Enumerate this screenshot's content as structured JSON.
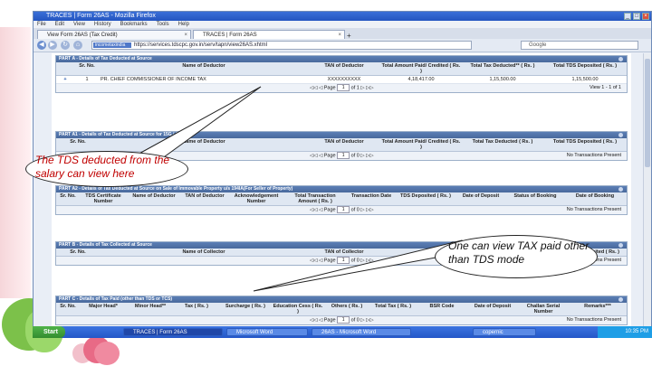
{
  "window": {
    "title": "TRACES | Form 26AS - Mozilla Firefox",
    "controls": [
      "_",
      "□",
      "×"
    ]
  },
  "menu": [
    "File",
    "Edit",
    "View",
    "History",
    "Bookmarks",
    "Tools",
    "Help"
  ],
  "tabs": [
    {
      "label": "View Form 26AS (Tax Credit)"
    },
    {
      "label": "TRACES | Form 26AS"
    }
  ],
  "address": {
    "badge": "incometaxindia",
    "url": "https://services.tdscpc.gov.in/serv/tapn/view26AS.xhtml",
    "search_placeholder": "Google"
  },
  "panels": {
    "partA": {
      "header": "PART A - Details of Tax Deducted at Source",
      "columns": [
        "Sr. No.",
        "Name of Deductor",
        "TAN of Deductor",
        "Total Amount Paid/ Credited ( Rs. )",
        "Total Tax Deducted** ( Rs. )",
        "Total TDS Deposited ( Rs. )"
      ],
      "row": [
        "+",
        "1",
        "PR. CHIEF COMMISSIONER OF INCOME TAX",
        "XXXXXXXXXX",
        "4,18,417.00",
        "1,15,500.00",
        "1,15,500.00"
      ],
      "pager_label": "Page",
      "pager_value": "1",
      "pager_of": "of 1",
      "view": "View 1 - 1 of 1"
    },
    "partA1": {
      "header": "PART A1 - Details of Tax Deducted at Source for 15G / 15H",
      "columns": [
        "Sr. No.",
        "Name of Deductor",
        "TAN of Deductor",
        "Total Amount Paid/ Credited ( Rs. )",
        "Total Tax Deducted ( Rs. )",
        "Total TDS Deposited ( Rs. )"
      ],
      "pager_label": "Page",
      "pager_value": "1",
      "pager_of": "of 0",
      "view": "No Transactions Present"
    },
    "partA2": {
      "header": "PART A2 - Details of Tax Deducted at Source on Sale of Immovable Property u/s 194IA(For Seller of Property)",
      "columns": [
        "Sr. No.",
        "TDS Certificate Number",
        "Name of Deductor",
        "TAN of Deductor",
        "Acknowledgement Number",
        "Total Transaction Amount ( Rs. )",
        "Transaction Date",
        "TDS Deposited ( Rs. )",
        "Date of Deposit",
        "Status of Booking",
        "Date of Booking"
      ],
      "pager_label": "Page",
      "pager_value": "1",
      "pager_of": "of 0",
      "view": "No Transactions Present"
    },
    "partB": {
      "header": "PART B - Details of Tax Collected at Source",
      "columns": [
        "Sr. No.",
        "Name of Collector",
        "TAN of Collector",
        "Total TCS Deposited ( Rs. )"
      ],
      "pager_label": "Page",
      "pager_value": "1",
      "pager_of": "of 0",
      "view": "No Transactions Present"
    },
    "partC": {
      "header": "PART C - Details of Tax Paid (other than TDS or TCS)",
      "columns": [
        "Sr. No.",
        "Major Head*",
        "Minor Head**",
        "Tax ( Rs. )",
        "Surcharge ( Rs. )",
        "Education Cess ( Rs. )",
        "Others ( Rs. )",
        "Total Tax ( Rs. )",
        "BSR Code",
        "Date of Deposit",
        "Challan Serial Number",
        "Remarks***"
      ],
      "pager_label": "Page",
      "pager_value": "1",
      "pager_of": "of 0",
      "view": "No Transactions Present"
    }
  },
  "taskbar": {
    "start": "Start",
    "tasks": [
      "TRACES | Form 26AS",
      "Microsoft Word",
      "26AS - Microsoft Word",
      "copernic"
    ],
    "tray": "10:35 PM"
  },
  "callouts": {
    "left": "The TDS deducted from the salary can view here",
    "right": "One can view TAX paid other than TDS mode"
  },
  "colors": {
    "panel_header": "#4f6fa3",
    "callout_text_left": "#c00000",
    "taskbar": "#2a5dcc",
    "start": "#3a9a35"
  }
}
